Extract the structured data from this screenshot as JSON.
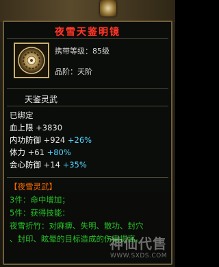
{
  "tooltip": {
    "title": "夜雪天鉴明镜",
    "level_req": "携带等级：85级",
    "grade": "品阶：天阶",
    "category": "天鉴灵武",
    "bound": "已绑定",
    "stats": [
      {
        "label": "血上限",
        "value": " +3830",
        "bonus": ""
      },
      {
        "label": "内功防御",
        "value": " +924",
        "bonus": " +26%"
      },
      {
        "label": "体力",
        "value": " +61",
        "bonus": " +80%"
      },
      {
        "label": "会心防御",
        "value": " +14",
        "bonus": " +35%"
      }
    ],
    "set": {
      "name": "【夜雪灵武】",
      "effects": [
        "3件：命中增加；",
        "5件：获得技能：",
        "夜雪折竹：对麻痹、失明、散功、封穴",
        "、封印、眩晕的目标造成的伤害提高。"
      ]
    }
  },
  "watermark": {
    "big": "神仙代售",
    "small": "WWW.SXDS.COM"
  }
}
